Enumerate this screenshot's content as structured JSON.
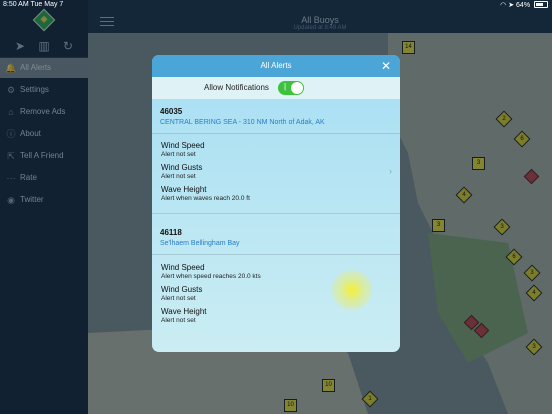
{
  "status": {
    "time": "8:50 AM",
    "date": "Tue May 7",
    "battery": "64%"
  },
  "sidebar": {
    "items": [
      {
        "label": "All Alerts",
        "icon": "bell-icon",
        "active": true
      },
      {
        "label": "Settings",
        "icon": "gear-icon"
      },
      {
        "label": "Remove Ads",
        "icon": "tag-icon"
      },
      {
        "label": "About",
        "icon": "info-icon"
      },
      {
        "label": "Tell A Friend",
        "icon": "share-icon"
      },
      {
        "label": "Rate",
        "icon": "dots-icon"
      },
      {
        "label": "Twitter",
        "icon": "twitter-icon"
      }
    ]
  },
  "header": {
    "title": "All Buoys",
    "subtitle": "Updated at 8:49 AM"
  },
  "modal": {
    "title": "All Alerts",
    "notifications_label": "Allow Notifications",
    "notifications_on": true,
    "buoys": [
      {
        "id": "46035",
        "location": "CENTRAL BERING SEA - 310 NM North of Adak, AK",
        "alerts": [
          {
            "name": "Wind Speed",
            "desc": "Alert not set"
          },
          {
            "name": "Wind Gusts",
            "desc": "Alert not set"
          },
          {
            "name": "Wave Height",
            "desc": "Alert when waves reach 20.0 ft"
          }
        ]
      },
      {
        "id": "46118",
        "location": "Se'lhaem Bellingham Bay",
        "alerts": [
          {
            "name": "Wind Speed",
            "desc": "Alert when speed reaches 20.0 kts"
          },
          {
            "name": "Wind Gusts",
            "desc": "Alert not set"
          },
          {
            "name": "Wave Height",
            "desc": "Alert not set"
          }
        ]
      }
    ]
  },
  "map": {
    "markers": [
      "14",
      "2",
      "6",
      "3",
      "3",
      "4",
      "3",
      "3",
      "3",
      "6",
      "3",
      "4",
      "10",
      "1",
      "10"
    ]
  },
  "colors": {
    "accent": "#4ba5d6",
    "toggle": "#3ec23e",
    "link": "#2a7dc6"
  }
}
